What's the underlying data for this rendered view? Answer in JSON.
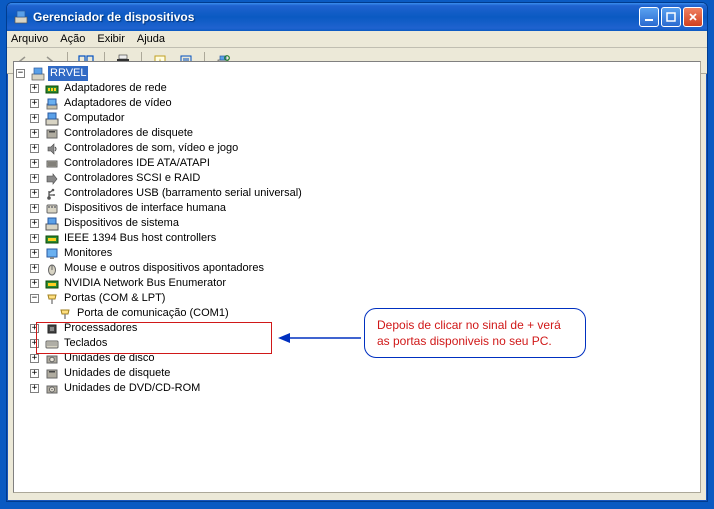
{
  "window": {
    "title": "Gerenciador de dispositivos"
  },
  "menu": {
    "arquivo": "Arquivo",
    "acao": "Ação",
    "exibir": "Exibir",
    "ajuda": "Ajuda"
  },
  "tree": {
    "root": "RRVEL",
    "items": {
      "i0": "Adaptadores de rede",
      "i1": "Adaptadores de vídeo",
      "i2": "Computador",
      "i3": "Controladores de disquete",
      "i4": "Controladores de som, vídeo e jogo",
      "i5": "Controladores IDE ATA/ATAPI",
      "i6": "Controladores SCSI e RAID",
      "i7": "Controladores USB (barramento serial universal)",
      "i8": "Dispositivos de interface humana",
      "i9": "Dispositivos de sistema",
      "i10": "IEEE 1394 Bus host controllers",
      "i11": "Monitores",
      "i12": "Mouse e outros dispositivos apontadores",
      "i13": "NVIDIA Network Bus Enumerator",
      "i14": "Portas (COM & LPT)",
      "i14_0": "Porta de comunicação (COM1)",
      "i15": "Processadores",
      "i16": "Teclados",
      "i17": "Unidades de disco",
      "i18": "Unidades de disquete",
      "i19": "Unidades de DVD/CD-ROM"
    }
  },
  "annotation": {
    "line1": "Depois de clicar no sinal de + verá",
    "line2": "as portas disponiveis no seu PC."
  },
  "expanders": {
    "plus": "+",
    "minus": "−"
  }
}
